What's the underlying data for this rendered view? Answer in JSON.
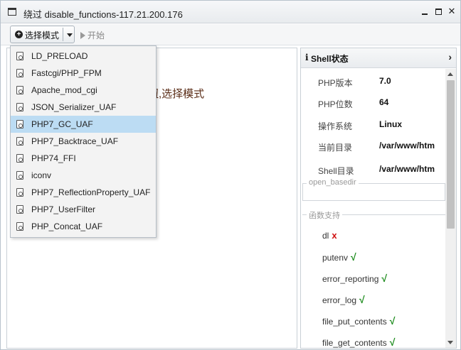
{
  "window": {
    "title": "绕过 disable_functions-117.21.200.176",
    "controls": [
      "minimize",
      "maximize",
      "close"
    ]
  },
  "toolbar": {
    "mode_button_label": "选择模式",
    "start_button_label": "开始"
  },
  "main": {
    "hint_text": "钮,选择模式"
  },
  "dropdown": {
    "items": [
      {
        "label": "LD_PRELOAD",
        "selected": false
      },
      {
        "label": "Fastcgi/PHP_FPM",
        "selected": false
      },
      {
        "label": "Apache_mod_cgi",
        "selected": false
      },
      {
        "label": "JSON_Serializer_UAF",
        "selected": false
      },
      {
        "label": "PHP7_GC_UAF",
        "selected": true
      },
      {
        "label": "PHP7_Backtrace_UAF",
        "selected": false
      },
      {
        "label": "PHP74_FFI",
        "selected": false
      },
      {
        "label": "iconv",
        "selected": false
      },
      {
        "label": "PHP7_ReflectionProperty_UAF",
        "selected": false
      },
      {
        "label": "PHP7_UserFilter",
        "selected": false
      },
      {
        "label": "PHP_Concat_UAF",
        "selected": false
      }
    ]
  },
  "shell_panel": {
    "title": "Shell状态",
    "info": [
      {
        "key": "PHP版本",
        "value": "7.0"
      },
      {
        "key": "PHP位数",
        "value": "64"
      },
      {
        "key": "操作系统",
        "value": "Linux"
      },
      {
        "key": "当前目录",
        "value": "/var/www/htm"
      },
      {
        "key": "Shell目录",
        "value": "/var/www/htm"
      }
    ],
    "open_basedir_label": "open_basedir",
    "functions_label": "函数支持",
    "functions": [
      {
        "name": "dl",
        "mark": "x",
        "supported": false
      },
      {
        "name": "putenv",
        "mark": "√",
        "supported": true
      },
      {
        "name": "error_reporting",
        "mark": "√",
        "supported": true
      },
      {
        "name": "error_log",
        "mark": "√",
        "supported": true
      },
      {
        "name": "file_put_contents",
        "mark": "√",
        "supported": true
      },
      {
        "name": "file_get_contents",
        "mark": "√",
        "supported": true
      }
    ]
  },
  "colors": {
    "selected_item_bg": "#bcdcf3",
    "supported_mark": "#1a8a1a",
    "unsupported_mark": "#d01010",
    "hint_text": "#5a2c16"
  }
}
